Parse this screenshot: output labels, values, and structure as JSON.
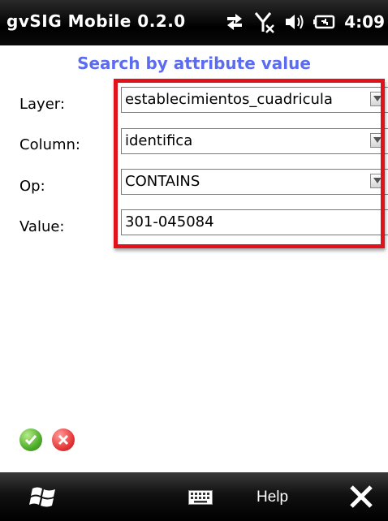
{
  "app": {
    "title": "gvSIG Mobile 0.2.0",
    "clock": "4:09"
  },
  "form": {
    "heading": "Search by attribute value",
    "layer_label": "Layer:",
    "layer_value": "establecimientos_cuadricula",
    "column_label": "Column:",
    "column_value": "identifica",
    "op_label": "Op:",
    "op_value": "CONTAINS",
    "value_label": "Value:",
    "value_value": "301-045084"
  },
  "bottom_bar": {
    "help_label": "Help"
  },
  "colors": {
    "heading": "#5b6cf0",
    "highlight_frame": "#e0131d",
    "ok": "#4fae2b",
    "cancel": "#e83a3a"
  }
}
